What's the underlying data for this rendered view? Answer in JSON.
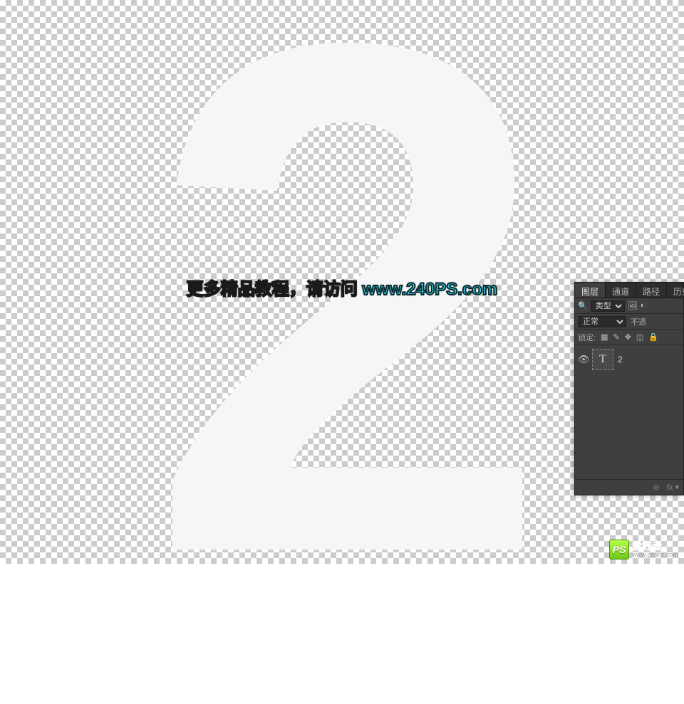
{
  "canvas": {
    "glyph": "2"
  },
  "overlay": {
    "prefix": "更多精品教程，请访问 ",
    "url": "www.240PS.com"
  },
  "panel": {
    "tabs": [
      "图层",
      "通道",
      "路径",
      "历史"
    ],
    "active_tab_index": 0,
    "filter": {
      "label": "类型"
    },
    "blend": {
      "mode": "正常",
      "opacity_label": "不透"
    },
    "lock": {
      "label": "锁定:"
    },
    "layers": [
      {
        "name": "2",
        "type_badge": "T"
      }
    ],
    "footer": {
      "link": "⊝",
      "fx": "fx"
    }
  },
  "watermark": {
    "logo_text": "PS",
    "label": "爱好者",
    "sub": "www.psahz.com"
  }
}
